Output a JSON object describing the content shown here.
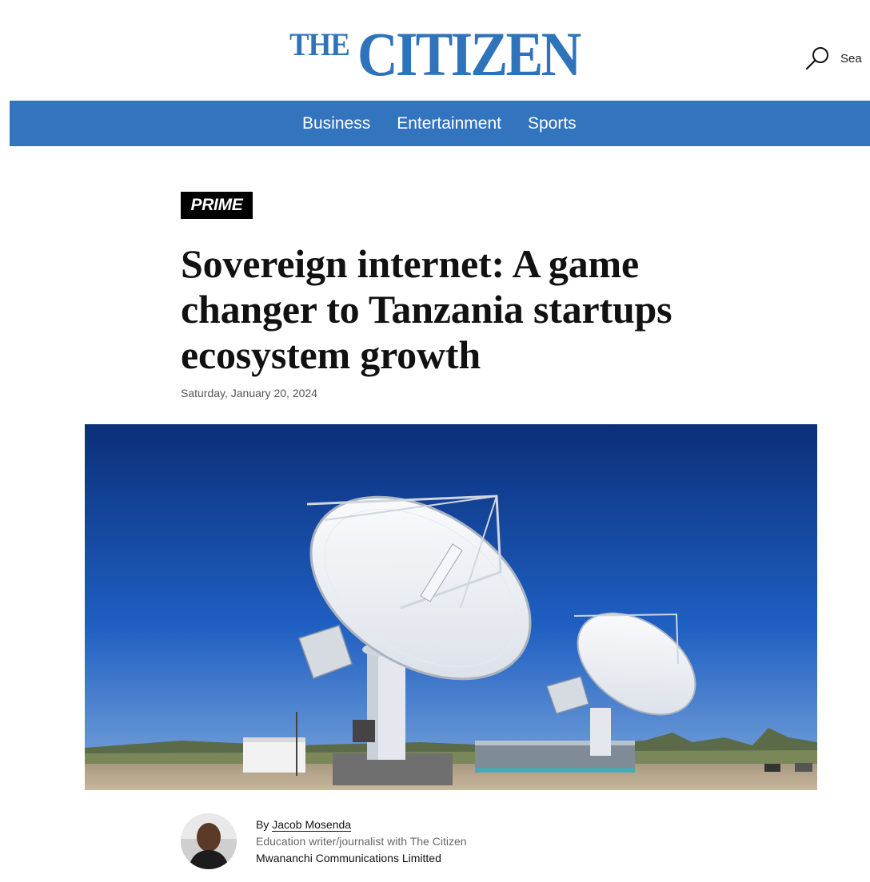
{
  "masthead": {
    "logo_small": "THE",
    "logo_large": "CITIZEN",
    "search_label": "Sea",
    "search_icon": "search-icon",
    "brand_color": "#2f73bb"
  },
  "nav": {
    "background": "#3274bd",
    "items": [
      {
        "label": "Business"
      },
      {
        "label": "Entertainment"
      },
      {
        "label": "Sports"
      }
    ]
  },
  "article": {
    "badge": "PRIME",
    "headline": "Sovereign internet: A game changer to Tanzania startups ecosystem growth",
    "date": "Saturday, January 20, 2024",
    "image_subject": "satellite-dish-antennas"
  },
  "byline": {
    "prefix": "By ",
    "author": "Jacob Mosenda",
    "role": "Education writer/journalist with The Citizen",
    "organization": "Mwananchi Communications Limitted"
  }
}
